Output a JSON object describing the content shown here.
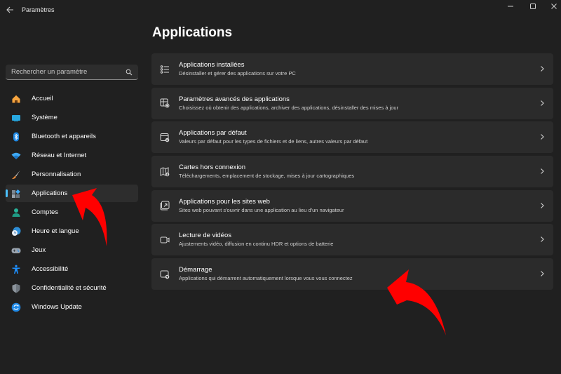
{
  "window": {
    "title": "Paramètres",
    "controls": [
      "minimize",
      "maximize",
      "close"
    ]
  },
  "search": {
    "placeholder": "Rechercher un paramètre",
    "value": ""
  },
  "sidebar": {
    "active": "Applications",
    "items": [
      {
        "label": "Accueil",
        "icon": "home-icon",
        "color": "#f7a53f"
      },
      {
        "label": "Système",
        "icon": "system-monitor-icon",
        "color": "#28a8e0"
      },
      {
        "label": "Bluetooth et appareils",
        "icon": "bluetooth-icon",
        "color": "#1e88e5"
      },
      {
        "label": "Réseau et Internet",
        "icon": "wifi-icon",
        "color": "#3fa9f5"
      },
      {
        "label": "Personnalisation",
        "icon": "paintbrush-icon",
        "color": "#e88a3b"
      },
      {
        "label": "Applications",
        "icon": "apps-icon",
        "color": "#8a8a8a"
      },
      {
        "label": "Comptes",
        "icon": "person-icon",
        "color": "#27b39a"
      },
      {
        "label": "Heure et langue",
        "icon": "clock-globe-icon",
        "color": "#2f8fd8"
      },
      {
        "label": "Jeux",
        "icon": "gamepad-icon",
        "color": "#9aa3ad"
      },
      {
        "label": "Accessibilité",
        "icon": "accessibility-icon",
        "color": "#1e90ff"
      },
      {
        "label": "Confidentialité et sécurité",
        "icon": "shield-icon",
        "color": "#8c949c"
      },
      {
        "label": "Windows Update",
        "icon": "update-icon",
        "color": "#1e88e5"
      }
    ]
  },
  "main": {
    "title": "Applications",
    "cards": [
      {
        "title": "Applications installées",
        "desc": "Désinstaller et gérer des applications sur votre PC",
        "icon": "list-icon"
      },
      {
        "title": "Paramètres avancés des applications",
        "desc": "Choisissez où obtenir des applications, archiver des applications, désinstaller des mises à jour",
        "icon": "apps-gear-icon"
      },
      {
        "title": "Applications par défaut",
        "desc": "Valeurs par défaut pour les types de fichiers et de liens, autres valeurs par défaut",
        "icon": "default-app-icon"
      },
      {
        "title": "Cartes hors connexion",
        "desc": "Téléchargements, emplacement de stockage, mises à jour cartographiques",
        "icon": "offline-map-icon"
      },
      {
        "title": "Applications pour les sites web",
        "desc": "Sites web pouvant s'ouvrir dans une application au lieu d'un navigateur",
        "icon": "web-app-icon"
      },
      {
        "title": "Lecture de vidéos",
        "desc": "Ajustements vidéo, diffusion en continu HDR et options de batterie",
        "icon": "video-camera-icon"
      },
      {
        "title": "Démarrage",
        "desc": "Applications qui démarrent automatiquement lorsque vous vous connectez",
        "icon": "startup-icon"
      }
    ]
  },
  "annotations": {
    "arrow_color": "#ff0000"
  }
}
